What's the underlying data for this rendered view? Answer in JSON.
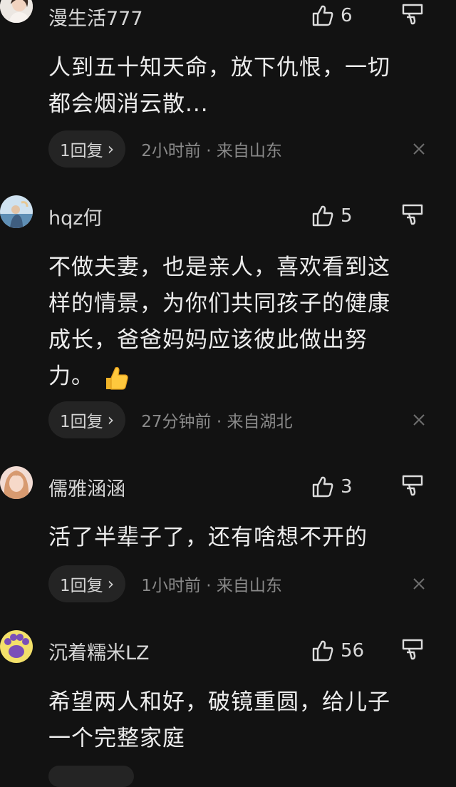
{
  "comments": [
    {
      "user": "漫生活777",
      "likes": "6",
      "lines": [
        "人到五十知天命，放下仇恨，一切",
        "都会烟消云散..."
      ],
      "reply_label": "1回复",
      "time": "2小时前 · 来自山东"
    },
    {
      "user": "hqz何",
      "likes": "5",
      "lines": [
        "不做夫妻，也是亲人，喜欢看到这",
        "样的情景，为你们共同孩子的健康",
        "成长，爸爸妈妈应该彼此做出努",
        "力。"
      ],
      "reply_label": "1回复",
      "time": "27分钟前 · 来自湖北"
    },
    {
      "user": "儒雅涵涵",
      "likes": "3",
      "lines": [
        "活了半辈子了，还有啥想不开的"
      ],
      "reply_label": "1回复",
      "time": "1小时前 · 来自山东"
    },
    {
      "user": "沉着糯米LZ",
      "likes": "56",
      "lines": [
        "希望两人和好，破镜重圆，给儿子",
        "一个完整家庭"
      ]
    }
  ],
  "icons": {
    "like": "thumbs-up-outline-icon",
    "dislike": "thumbs-down-outline-icon",
    "close": "close-x-icon",
    "chevron": "chevron-right-icon",
    "emoji": "thumbs-up-emoji"
  },
  "colors": {
    "background": "#121212",
    "pill": "#242424",
    "meta_text": "#8a8a8a"
  }
}
